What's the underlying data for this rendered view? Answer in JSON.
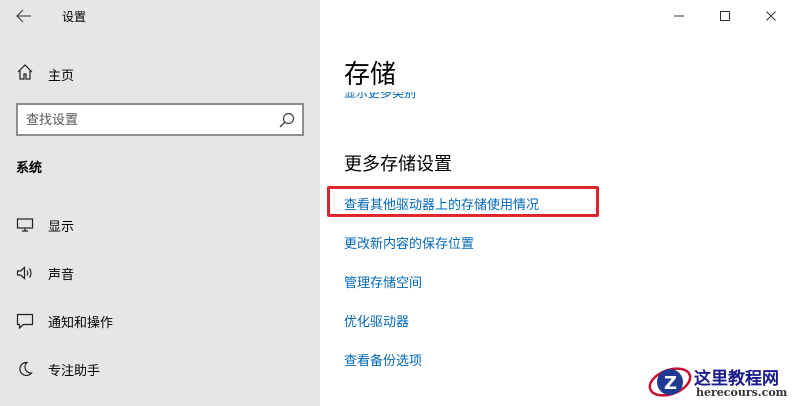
{
  "window": {
    "title": "设置",
    "controls": {
      "minimize": "—",
      "maximize": "☐",
      "close": "✕"
    }
  },
  "sidebar": {
    "home_label": "主页",
    "search_placeholder": "查找设置",
    "section_title": "系统",
    "items": [
      {
        "label": "显示",
        "icon": "monitor-icon"
      },
      {
        "label": "声音",
        "icon": "speaker-icon"
      },
      {
        "label": "通知和操作",
        "icon": "message-icon"
      },
      {
        "label": "专注助手",
        "icon": "moon-icon"
      }
    ]
  },
  "main": {
    "title": "存储",
    "cut_link": "显示更多类别",
    "more_title": "更多存储设置",
    "links": [
      {
        "label": "查看其他驱动器上的存储使用情况",
        "highlighted": true
      },
      {
        "label": "更改新内容的保存位置",
        "highlighted": false
      },
      {
        "label": "管理存储空间",
        "highlighted": false
      },
      {
        "label": "优化驱动器",
        "highlighted": false
      },
      {
        "label": "查看备份选项",
        "highlighted": false
      }
    ]
  },
  "watermark": {
    "title": "这里教程网",
    "url": "herecours.com"
  },
  "colors": {
    "sidebar_bg": "#e6e6e6",
    "link": "#0067b8",
    "highlight": "#e0242c"
  }
}
